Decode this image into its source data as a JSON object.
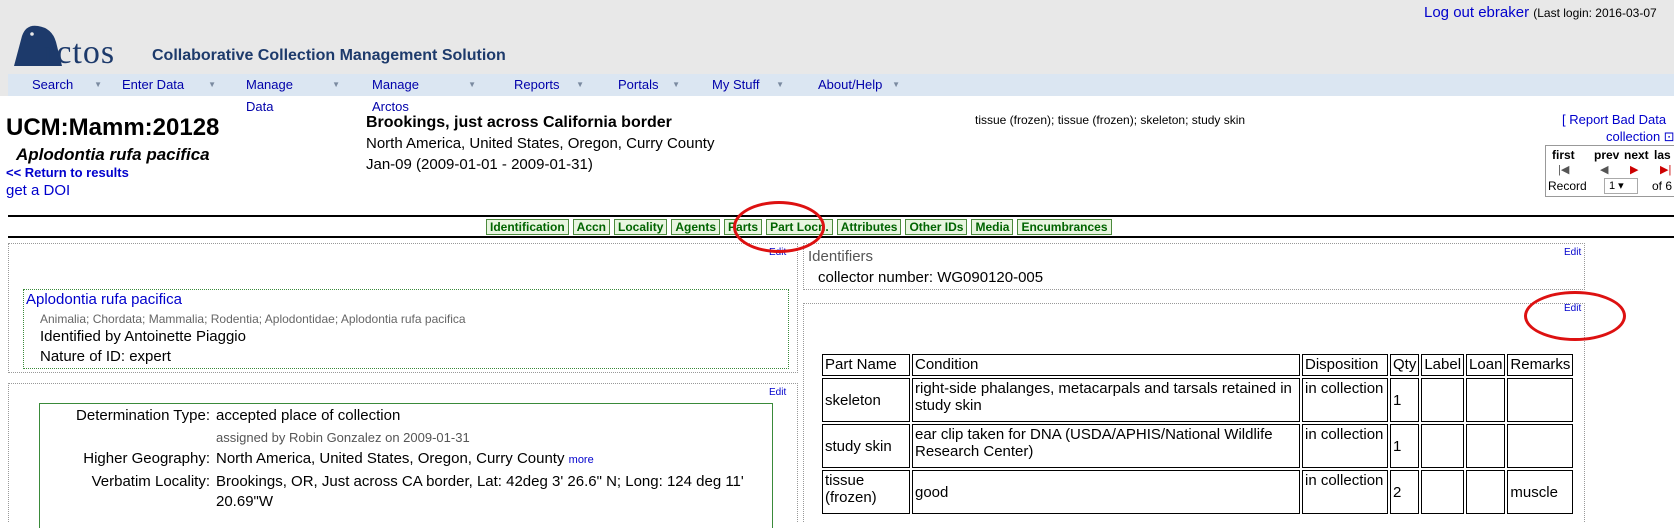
{
  "header": {
    "logo_text": "rctos",
    "tagline": "Collaborative Collection Management Solution",
    "logout_text": "Log out ebraker",
    "last_login": "(Last login: 2016-03-07"
  },
  "nav": [
    {
      "label": "Search"
    },
    {
      "label": "Enter Data"
    },
    {
      "label": "Manage Data"
    },
    {
      "label": "Manage Arctos"
    },
    {
      "label": "Reports"
    },
    {
      "label": "Portals"
    },
    {
      "label": "My Stuff"
    },
    {
      "label": "About/Help"
    }
  ],
  "record": {
    "guid": "UCM:Mamm:20128",
    "scientific_name": "Aplodontia rufa pacifica",
    "return_link": "<< Return to results",
    "doi_link": "get a DOI",
    "locality_title": "Brookings, just across California border",
    "higher_geography": "North America, United States, Oregon, Curry County",
    "date": "Jan-09 (2009-01-01 - 2009-01-31)",
    "parts_summary": "tissue (frozen); tissue (frozen); skeleton; study skin",
    "report_bad_data": "[ Report Bad Data",
    "report_collection": "collection ⊡"
  },
  "pager": {
    "first": "first",
    "prev": "prev",
    "next": "next",
    "last": "las",
    "record_label": "Record",
    "record_value": "1 ▾",
    "of_label": "of 6"
  },
  "tabs": [
    {
      "label": "Identification"
    },
    {
      "label": "Accn"
    },
    {
      "label": "Locality"
    },
    {
      "label": "Agents"
    },
    {
      "label": "Parts"
    },
    {
      "label": "Part Locn."
    },
    {
      "label": "Attributes"
    },
    {
      "label": "Other IDs"
    },
    {
      "label": "Media"
    },
    {
      "label": "Encumbrances"
    }
  ],
  "identification": {
    "edit": "Edit",
    "scientific_name": "Aplodontia rufa pacifica",
    "taxonomy": "Animalia; Chordata; Mammalia; Rodentia; Aplodontidae; Aplodontia rufa pacifica",
    "identified_by": "Identified by Antoinette Piaggio",
    "nature": "Nature of ID: expert"
  },
  "locality": {
    "edit": "Edit",
    "determination_type_label": "Determination Type:",
    "determination_type": "accepted place of collection",
    "assigned_by": "assigned by Robin Gonzalez on 2009-01-31",
    "higher_geography_label": "Higher Geography:",
    "higher_geography": "North America, United States, Oregon, Curry County",
    "more": "more",
    "verbatim_label": "Verbatim Locality:",
    "verbatim_line1": "Brookings, OR, Just across CA border, Lat: 42deg 3' 26.6\" N; Long: 124 deg 11'",
    "verbatim_line2": "20.69\"W"
  },
  "identifiers": {
    "title": "Identifiers",
    "edit": "Edit",
    "collector_number": "collector number: WG090120-005"
  },
  "parts": {
    "edit": "Edit",
    "headers": [
      "Part Name",
      "Condition",
      "Disposition",
      "Qty",
      "Label",
      "Loan",
      "Remarks"
    ],
    "rows": [
      {
        "name": "skeleton",
        "condition": "right-side phalanges, metacarpals and tarsals retained in study skin",
        "disposition": "in collection",
        "qty": "1",
        "label": "",
        "loan": "",
        "remarks": ""
      },
      {
        "name": "study skin",
        "condition": "ear clip taken for DNA (USDA/APHIS/National Wildlife Research Center)",
        "disposition": "in collection",
        "qty": "1",
        "label": "",
        "loan": "",
        "remarks": ""
      },
      {
        "name": "tissue (frozen)",
        "condition": "good",
        "disposition": "in collection",
        "qty": "2",
        "label": "",
        "loan": "",
        "remarks": "muscle"
      }
    ]
  }
}
